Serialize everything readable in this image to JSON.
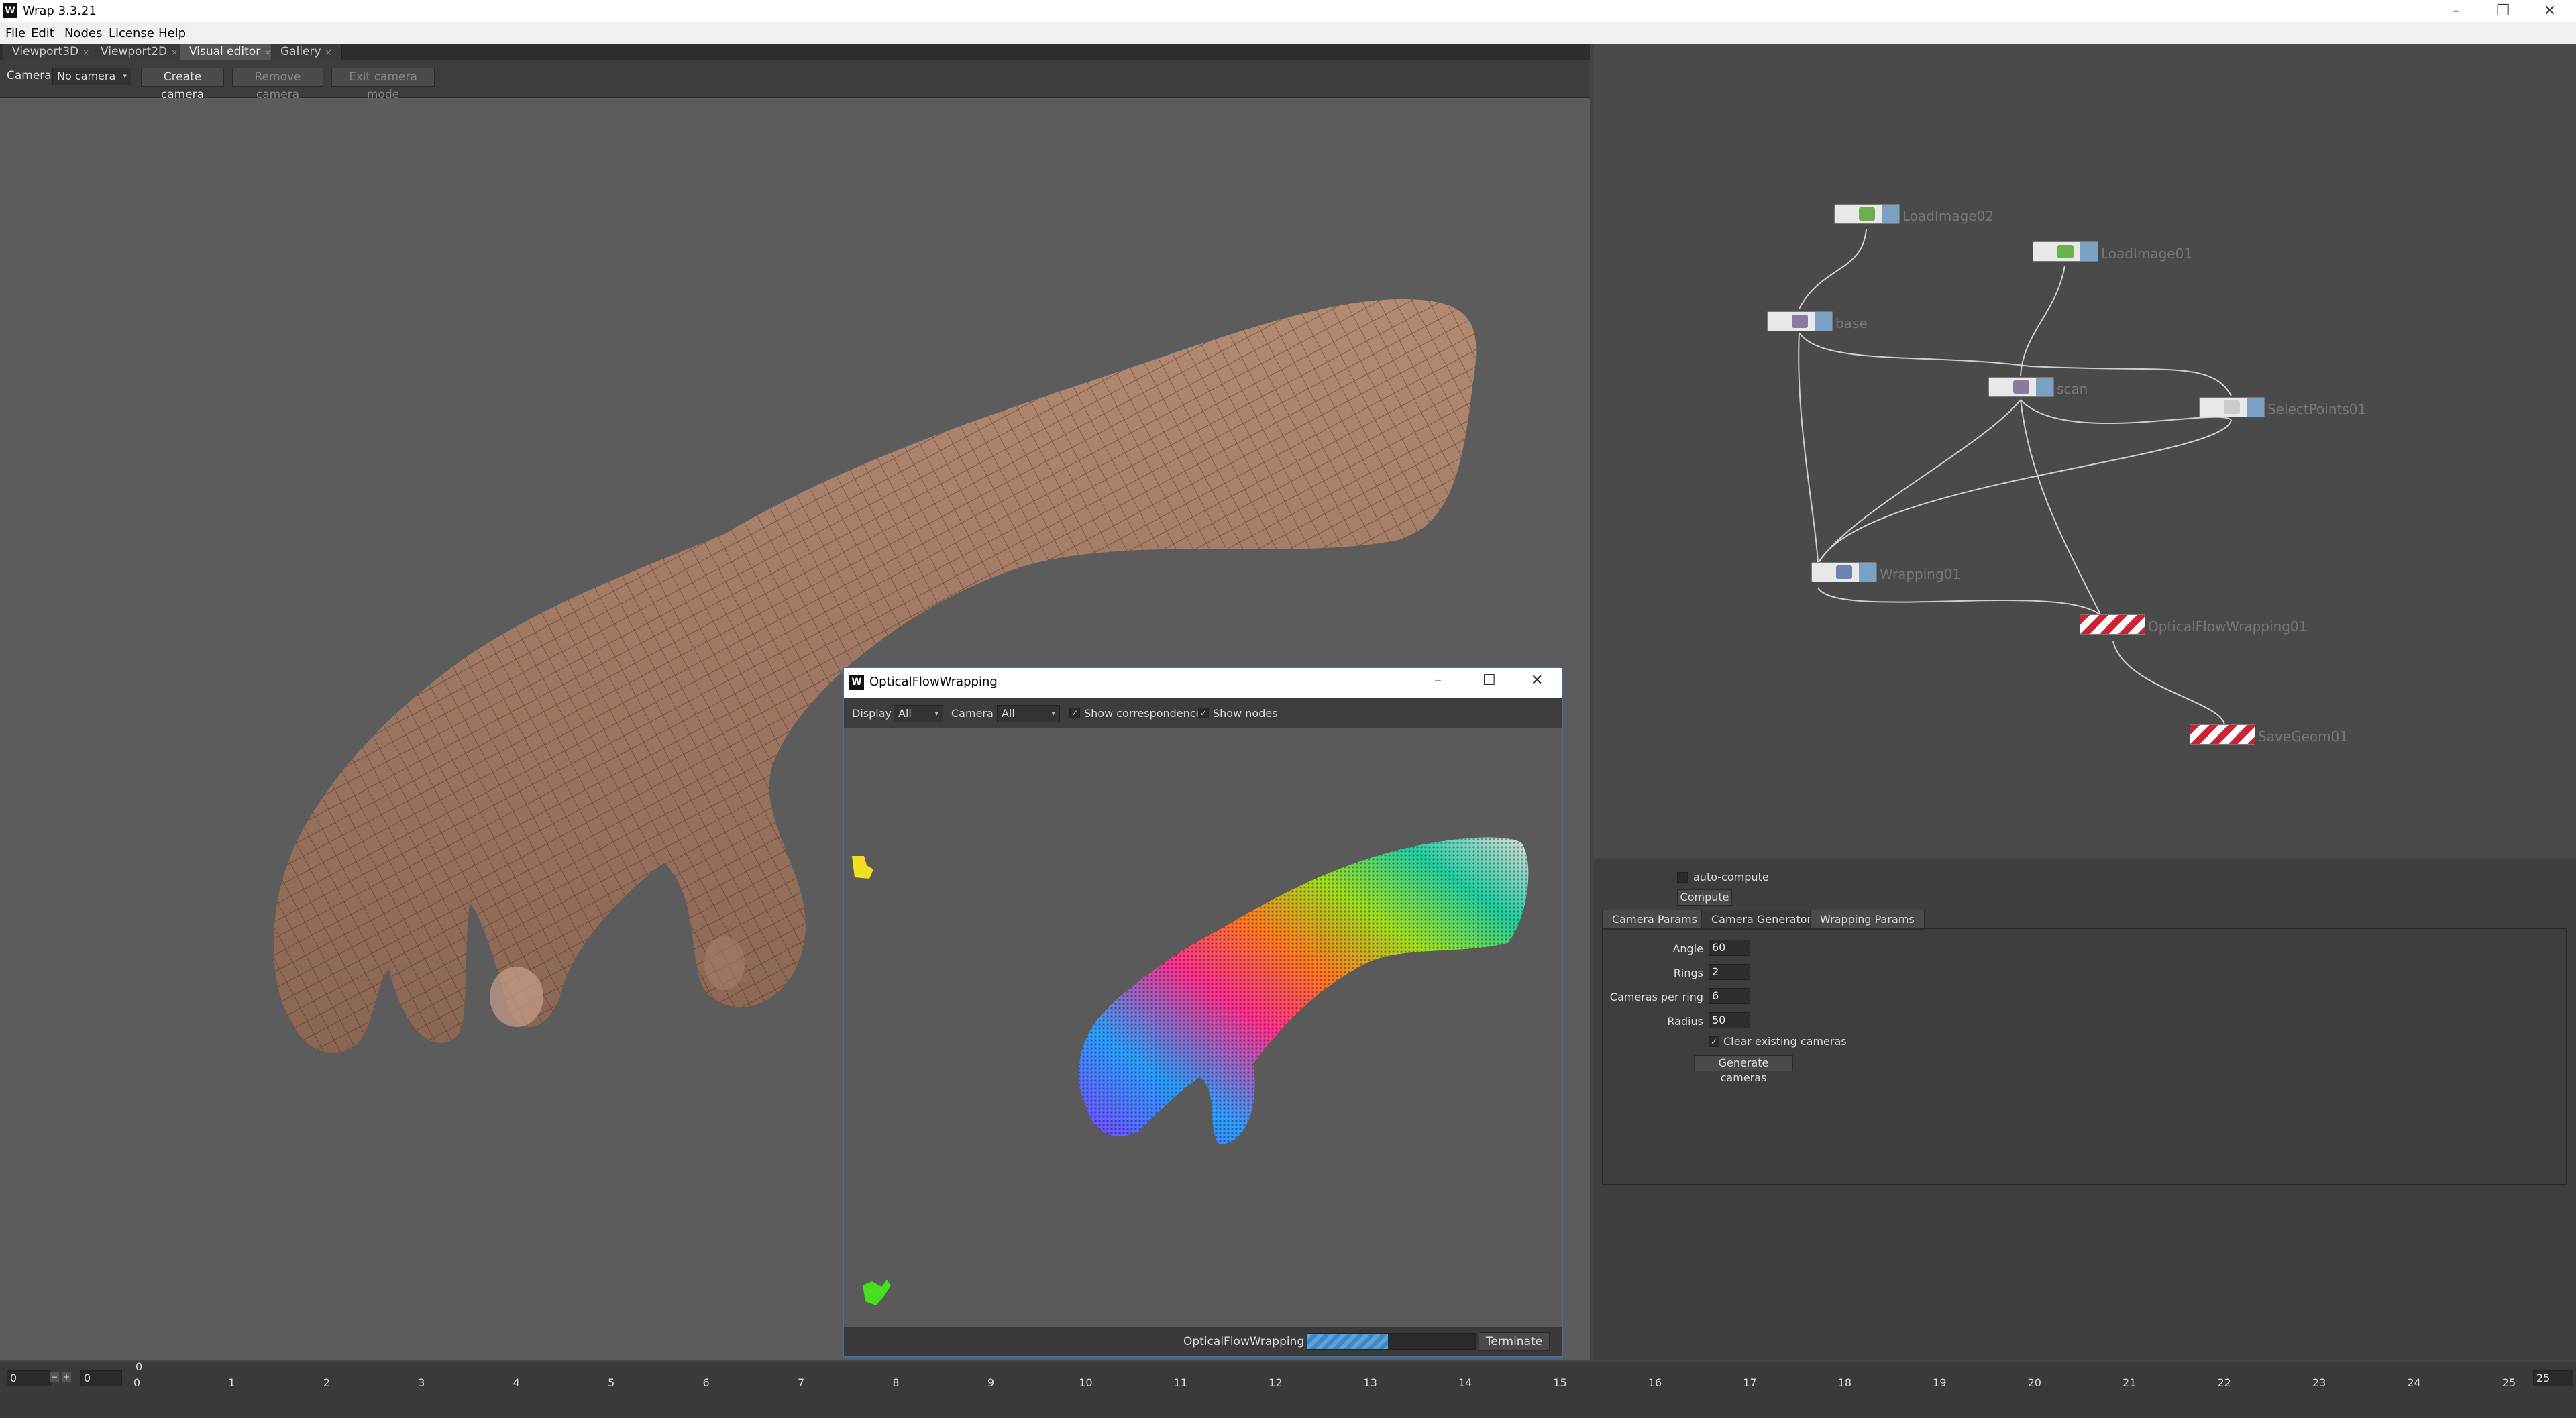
{
  "app": {
    "title": "Wrap 3.3.21",
    "logo": "W"
  },
  "menu": [
    "File",
    "Edit",
    "Nodes",
    "License",
    "Help"
  ],
  "tabs": [
    "Viewport3D",
    "Viewport2D",
    "Visual editor",
    "Gallery"
  ],
  "camera_toolbar": {
    "label": "Camera",
    "selected": "No camera",
    "create": "Create camera",
    "remove": "Remove camera",
    "exit": "Exit camera mode"
  },
  "nodes": {
    "loadimage02": "LoadImage02",
    "loadimage01": "LoadImage01",
    "base": "base",
    "scan": "scan",
    "selectpoints01": "SelectPoints01",
    "wrapping01": "Wrapping01",
    "opticalflow": "OpticalFlowWrapping01",
    "savegeom01": "SaveGeom01"
  },
  "props": {
    "auto_compute": "auto-compute",
    "compute": "Compute",
    "tabs": [
      "Camera Params",
      "Camera Generator",
      "Wrapping Params"
    ],
    "fields": [
      {
        "label": "Angle",
        "value": "60"
      },
      {
        "label": "Rings",
        "value": "2"
      },
      {
        "label": "Cameras per ring",
        "value": "6"
      },
      {
        "label": "Radius",
        "value": "50"
      }
    ],
    "clear_existing": "Clear existing cameras",
    "generate": "Generate cameras"
  },
  "dialog": {
    "title": "OpticalFlowWrapping",
    "display_label": "Display",
    "display_value": "All",
    "camera_label": "Camera",
    "camera_value": "All",
    "show_corr": "Show correspondences",
    "show_nodes": "Show nodes",
    "progress_label": "OpticalFlowWrapping",
    "progress": 0.48,
    "terminate": "Terminate"
  },
  "timeline": {
    "start": "0",
    "current": "0",
    "marker": "0",
    "end": "25",
    "ticks": [
      "0",
      "1",
      "2",
      "3",
      "4",
      "5",
      "6",
      "7",
      "8",
      "9",
      "10",
      "11",
      "12",
      "13",
      "14",
      "15",
      "16",
      "17",
      "18",
      "19",
      "20",
      "21",
      "22",
      "23",
      "24",
      "25"
    ]
  }
}
